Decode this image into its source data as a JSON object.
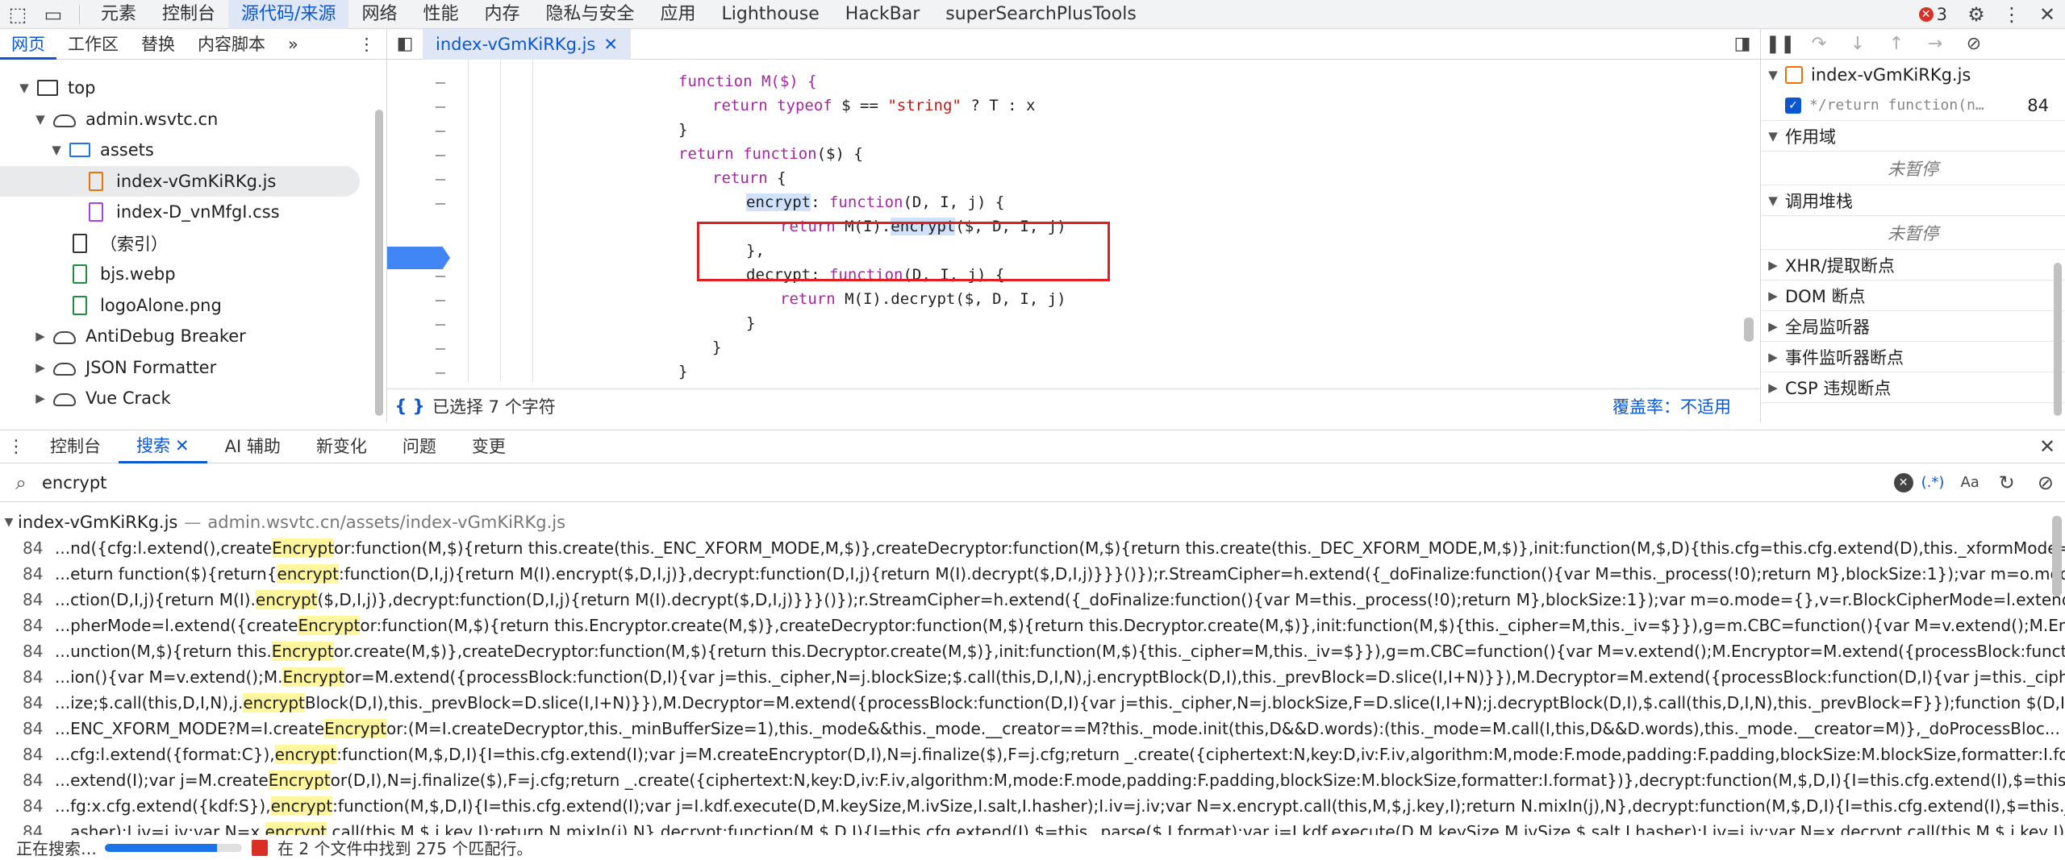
{
  "topbar": {
    "tabs": [
      "元素",
      "控制台",
      "源代码/来源",
      "网络",
      "性能",
      "内存",
      "隐私与安全",
      "应用",
      "Lighthouse",
      "HackBar",
      "superSearchPlusTools"
    ],
    "active_tab": "源代码/来源",
    "error_count": "3"
  },
  "navigator": {
    "tabs": [
      "网页",
      "工作区",
      "替换",
      "内容脚本"
    ],
    "more": "»",
    "tree": [
      {
        "label": "top",
        "icon": "frame-icon",
        "level": 0,
        "arrow": "▼"
      },
      {
        "label": "admin.wsvtc.cn",
        "icon": "cloud-icon",
        "level": 1,
        "arrow": "▼"
      },
      {
        "label": "assets",
        "icon": "folder-icon",
        "level": 2,
        "arrow": "▼"
      },
      {
        "label": "index-vGmKiRKg.js",
        "icon": "js-file-icon",
        "level": 3,
        "arrow": "",
        "selected": true
      },
      {
        "label": "index-D_vnMfgI.css",
        "icon": "css-file-icon",
        "level": 3,
        "arrow": ""
      },
      {
        "label": "（索引）",
        "icon": "document-file-icon",
        "level": 2,
        "arrow": ""
      },
      {
        "label": "bjs.webp",
        "icon": "image-file-icon",
        "level": 2,
        "arrow": ""
      },
      {
        "label": "logoAlone.png",
        "icon": "image-file-icon",
        "level": 2,
        "arrow": ""
      },
      {
        "label": "AntiDebug Breaker",
        "icon": "cloud-icon",
        "level": 1,
        "arrow": "▶"
      },
      {
        "label": "JSON Formatter",
        "icon": "cloud-icon",
        "level": 1,
        "arrow": "▶"
      },
      {
        "label": "Vue Crack",
        "icon": "cloud-icon",
        "level": 1,
        "arrow": "▶"
      }
    ]
  },
  "editor": {
    "tab_label": "index-vGmKiRKg.js",
    "status_selected": "已选择 7 个字符",
    "coverage_label": "覆盖率：",
    "coverage_value": "不适用",
    "code": {
      "l1": "function M($) {",
      "l2a": "return ",
      "l2b": "typeof",
      "l2c": " $ == ",
      "l2d": "\"string\"",
      "l2e": " ? T : x",
      "l3": "}",
      "l4a": "return ",
      "l4b": "function",
      "l4c": "($) {",
      "l5a": "return",
      "l5b": " {",
      "l6a": "encrypt",
      "l6b": ": ",
      "l6c": "function",
      "l6d": "(D, I, j) {",
      "l7a": "return",
      "l7b": " M(I).",
      "l7c": "encrypt",
      "l7d": "($, D, I, j)",
      "l8": "},",
      "l9a": "decrypt: ",
      "l9b": "function",
      "l9c": "(D, I, j) {",
      "l10a": "return",
      "l10b": " M(I).decrypt($, D, I, j)",
      "l11": "}",
      "l12": "}",
      "l13": "}"
    }
  },
  "debugger": {
    "breakpoint_file": "index-vGmKiRKg.js",
    "breakpoint_code": "*/return function(n…",
    "breakpoint_line": "84",
    "scope_title": "作用域",
    "scope_empty": "未暂停",
    "callstack_title": "调用堆栈",
    "callstack_empty": "未暂停",
    "sections": [
      "XHR/提取断点",
      "DOM 断点",
      "全局监听器",
      "事件监听器断点",
      "CSP 违规断点"
    ]
  },
  "drawer": {
    "tabs": [
      "控制台",
      "搜索",
      "AI 辅助",
      "新变化",
      "问题",
      "变更"
    ],
    "active_tab": "搜索",
    "search_value": "encrypt",
    "regex_label": "(.*)",
    "case_label": "Aa"
  },
  "results": {
    "file": "index-vGmKiRKg.js",
    "path": "admin.wsvtc.cn/assets/index-vGmKiRKg.js",
    "lines": [
      {
        "num": "84",
        "pre": "...nd({cfg:l.extend(),create",
        "match": "Encrypt",
        "post": "or:function(M,$){return this.create(this._ENC_XFORM_MODE,M,$)},createDecryptor:function(M,$){return this.create(this._DEC_XFORM_MODE,M,$)},init:function(M,$,D){this.cfg=this.cfg.extend(D),this._xformMode=..."
      },
      {
        "num": "84",
        "pre": "...eturn function($){return{",
        "match": "encrypt",
        "post": ":function(D,I,j){return M(I).encrypt($,D,I,j)},decrypt:function(D,I,j){return M(I).decrypt($,D,I,j)}}}()});r.StreamCipher=h.extend({_doFinalize:function(){var M=this._process(!0);return M},blockSize:1});var m=o.mode={},v=..."
      },
      {
        "num": "84",
        "pre": "...ction(D,I,j){return M(I).",
        "match": "encrypt",
        "post": "($,D,I,j)},decrypt:function(D,I,j){return M(I).decrypt($,D,I,j)}}}()});r.StreamCipher=h.extend({_doFinalize:function(){var M=this._process(!0);return M},blockSize:1});var m=o.mode={},v=r.BlockCipherMode=l.extend({creat..."
      },
      {
        "num": "84",
        "pre": "...pherMode=l.extend({create",
        "match": "Encrypt",
        "post": "or:function(M,$){return this.Encryptor.create(M,$)},createDecryptor:function(M,$){return this.Decryptor.create(M,$)},init:function(M,$){this._cipher=M,this._iv=$}}),g=m.CBC=function(){var M=v.extend();M.Encry..."
      },
      {
        "num": "84",
        "pre": "...unction(M,$){return this.",
        "match": "Encrypt",
        "post": "or.create(M,$)},createDecryptor:function(M,$){return this.Decryptor.create(M,$)},init:function(M,$){this._cipher=M,this._iv=$}}),g=m.CBC=function(){var M=v.extend();M.Encryptor=M.extend({processBlock:function..."
      },
      {
        "num": "84",
        "pre": "...ion(){var M=v.extend();M.",
        "match": "Encrypt",
        "post": "or=M.extend({processBlock:function(D,I){var j=this._cipher,N=j.blockSize;$.call(this,D,I,N),j.encryptBlock(D,I),this._prevBlock=D.slice(I,I+N)}}),M.Decryptor=M.extend({processBlock:function(D,I){var j=this._cipher,N..."
      },
      {
        "num": "84",
        "pre": "...ize;$.call(this,D,I,N),j.",
        "match": "encrypt",
        "post": "Block(D,I),this._prevBlock=D.slice(I,I+N)}}),M.Decryptor=M.extend({processBlock:function(D,I){var j=this._cipher,N=j.blockSize,F=D.slice(I,I+N);j.decryptBlock(D,I),$.call(this,D,I,N),this._prevBlock=F}});function $(D,I,j){var ..."
      },
      {
        "num": "84",
        "pre": "...ENC_XFORM_MODE?M=I.create",
        "match": "Encrypt",
        "post": "or:(M=I.createDecryptor,this._minBufferSize=1),this._mode&&this._mode.__creator==M?this._mode.init(this,D&&D.words):(this._mode=M.call(I,this,D&&D.words),this._mode.__creator=M)},_doProcessBloc..."
      },
      {
        "num": "84",
        "pre": "...cfg:l.extend({format:C}),",
        "match": "encrypt",
        "post": ":function(M,$,D,I){I=this.cfg.extend(I);var j=M.createEncryptor(D,I),N=j.finalize($),F=j.cfg;return _.create({ciphertext:N,key:D,iv:F.iv,algorithm:M,mode:F.mode,padding:F.padding,blockSize:M.blockSize,formatter:I.for..."
      },
      {
        "num": "84",
        "pre": "...extend(I);var j=M.create",
        "match": "Encrypt",
        "post": "or(D,I),N=j.finalize($),F=j.cfg;return _.create({ciphertext:N,key:D,iv:F.iv,algorithm:M,mode:F.mode,padding:F.padding,blockSize:M.blockSize,formatter:I.format})},decrypt:function(M,$,D,I){I=this.cfg.extend(I),$=this..."
      },
      {
        "num": "84",
        "pre": "...fg:x.cfg.extend({kdf:S}),",
        "match": "encrypt",
        "post": ":function(M,$,D,I){I=this.cfg.extend(I);var j=I.kdf.execute(D,M.keySize,M.ivSize,I.salt,I.hasher);I.iv=j.iv;var N=x.encrypt.call(this,M,$,j.key,I);return N.mixIn(j),N},decrypt:function(M,$,D,I){I=this.cfg.extend(I),$=this._pars..."
      },
      {
        "num": "84",
        "pre": "...asher);I.iv=j.iv;var N=x.",
        "match": "encrypt",
        "post": ".call(this,M,$,j.key,I);return N.mixIn(j),N},decrypt:function(M,$,D,I){I=this.cfg.extend(I),$=this._parse($,I.format);var j=I.kdf.execute(D,M.keySize,M.ivSize,$.salt,I.hasher);I.iv=j.iv;var N=x.decrypt.call(this,M,$,j.key,I);retur..."
      }
    ]
  },
  "status": {
    "searching": "正在搜索…",
    "found": "在 2 个文件中找到 275 个匹配行。",
    "progress": 0.82
  },
  "colors": {
    "accent": "#0b57d0",
    "highlight": "#fff59d",
    "redbox": "#e02020"
  }
}
